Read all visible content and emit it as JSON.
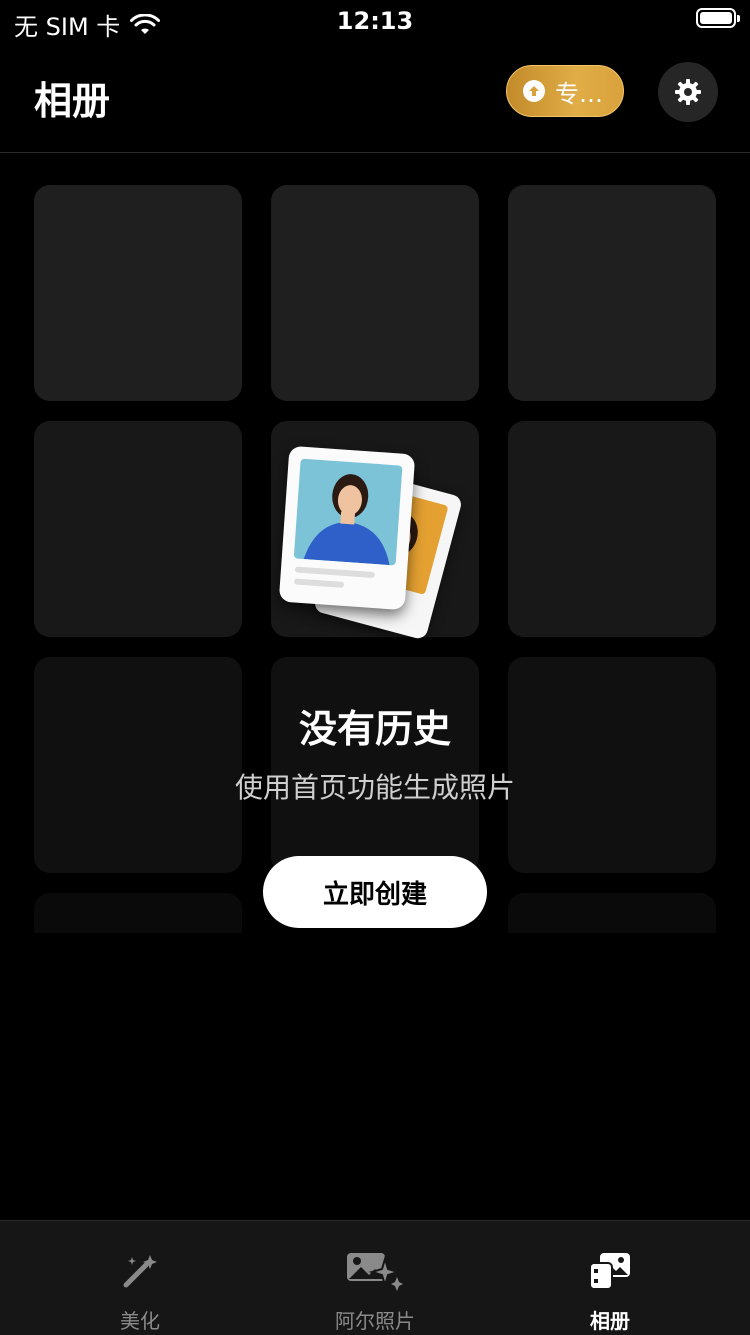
{
  "status_bar": {
    "carrier": "无 SIM 卡",
    "time": "12:13"
  },
  "header": {
    "title": "相册",
    "pro_label": "专…",
    "settings_icon": "gear-icon"
  },
  "empty_state": {
    "title": "没有历史",
    "subtitle": "使用首页功能生成照片",
    "button_label": "立即创建"
  },
  "tabs": [
    {
      "label": "美化",
      "icon": "magic-wand-icon",
      "active": false
    },
    {
      "label": "阿尔照片",
      "icon": "ai-photo-sparkle-icon",
      "active": false
    },
    {
      "label": "相册",
      "icon": "album-icon",
      "active": true
    }
  ],
  "colors": {
    "pro_gold": "#d9a13b",
    "background": "#000000",
    "tabbar": "#161616"
  }
}
